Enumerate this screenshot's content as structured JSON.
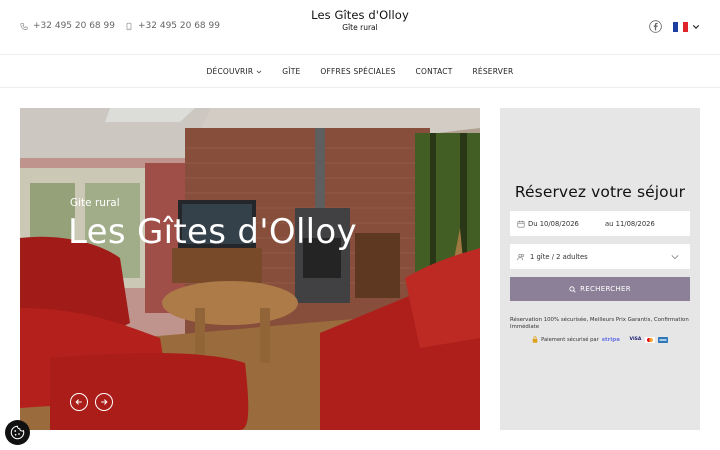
{
  "header": {
    "phones": [
      "+32 495 20 68 99",
      "+32 495 20 68 99"
    ],
    "brand_title": "Les Gîtes d'Olloy",
    "brand_subtitle": "Gîte rural",
    "icons": {
      "phone_1": "phone-icon",
      "phone_2": "mobile-icon",
      "social": "facebook-icon",
      "language": "french-flag-icon"
    }
  },
  "nav": {
    "items": [
      {
        "label": "DÉCOUVRIR",
        "has_dropdown": true
      },
      {
        "label": "GÎTE"
      },
      {
        "label": "OFFRES SPÉCIALES"
      },
      {
        "label": "CONTACT"
      },
      {
        "label": "RÉSERVER"
      }
    ]
  },
  "hero": {
    "kicker": "Gite rural",
    "title": "Les Gîtes d'Olloy",
    "prev_icon": "arrow-left-icon",
    "next_icon": "arrow-right-icon"
  },
  "booking": {
    "title": "Réservez votre séjour",
    "date_from": "Du 10/08/2026",
    "date_to": "au 11/08/2026",
    "guests": "1 gîte / 2 adultes",
    "search_label": "RECHERCHER",
    "note": "Réservation 100% sécurisée, Meilleurs Prix Garantis, Confirmation Immédiate",
    "secure_text": "Paiement sécurisé par",
    "payment_brand": "stripe",
    "cards": [
      "VISA"
    ]
  },
  "colors": {
    "accent": "#8b8098",
    "panel_bg": "#e6e6e6",
    "flag_blue": "#1f3fa0",
    "flag_white": "#ffffff",
    "flag_red": "#e0232a"
  }
}
